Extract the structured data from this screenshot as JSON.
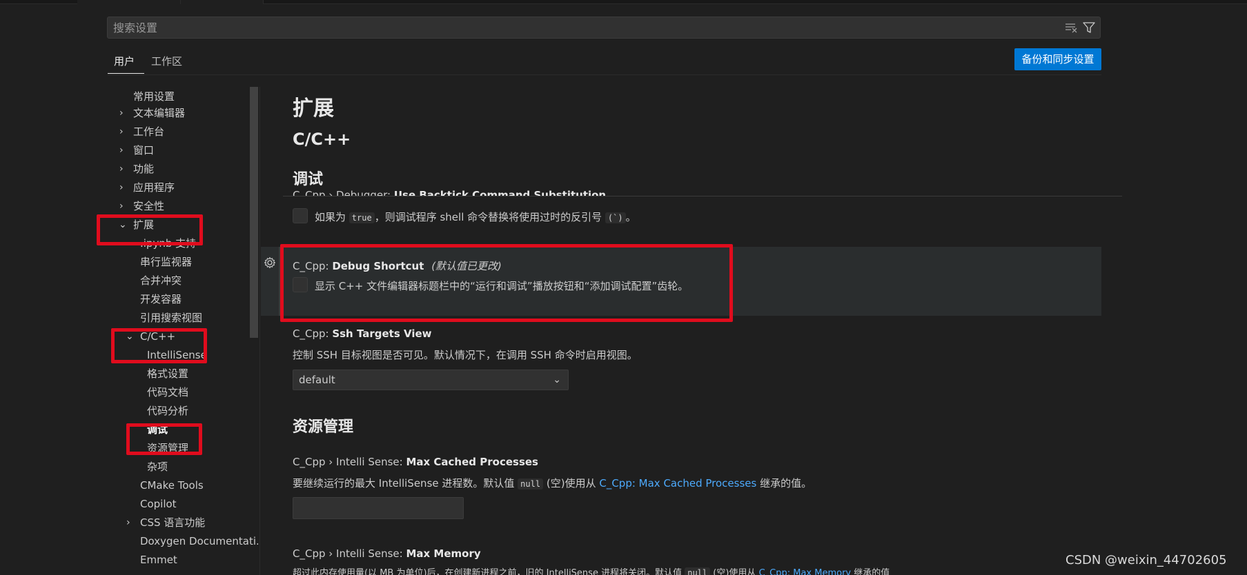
{
  "search": {
    "placeholder": "搜索设置"
  },
  "tabs": {
    "user": "用户",
    "workspace": "工作区"
  },
  "backup_button": "备份和同步设置",
  "sidebar": {
    "items": [
      {
        "label": "常用设置"
      },
      {
        "label": "文本编辑器"
      },
      {
        "label": "工作台"
      },
      {
        "label": "窗口"
      },
      {
        "label": "功能"
      },
      {
        "label": "应用程序"
      },
      {
        "label": "安全性"
      },
      {
        "label": "扩展"
      },
      {
        "label": ".ipynb 支持"
      },
      {
        "label": "串行监视器"
      },
      {
        "label": "合并冲突"
      },
      {
        "label": "开发容器"
      },
      {
        "label": "引用搜索视图"
      },
      {
        "label": "C/C++"
      },
      {
        "label": "IntelliSense"
      },
      {
        "label": "格式设置"
      },
      {
        "label": "代码文档"
      },
      {
        "label": "代码分析"
      },
      {
        "label": "调试"
      },
      {
        "label": "资源管理"
      },
      {
        "label": "杂项"
      },
      {
        "label": "CMake Tools"
      },
      {
        "label": "Copilot"
      },
      {
        "label": "CSS 语言功能"
      },
      {
        "label": "Doxygen Documentati..."
      },
      {
        "label": "Emmet"
      }
    ]
  },
  "main": {
    "h_extensions": "扩展",
    "h_cpp": "C/C++",
    "h_debug": "调试",
    "backtick": {
      "title_prefix": "C_Cpp › Debugger: ",
      "title_bold": "Use Backtick Command Substitution",
      "desc_pre": "如果为",
      "desc_code1": "true",
      "desc_mid": "，则调试程序 shell 命令替换将使用过时的反引号",
      "desc_code2": "(`)",
      "desc_post": "。"
    },
    "debug_shortcut": {
      "title_prefix": "C_Cpp: ",
      "title_bold": "Debug Shortcut",
      "modified": "(默认值已更改)",
      "desc": "显示 C++ 文件编辑器标题栏中的“运行和调试”播放按钮和“添加调试配置”齿轮。"
    },
    "ssh_targets": {
      "title_prefix": "C_Cpp: ",
      "title_bold": "Ssh Targets View",
      "desc": "控制 SSH 目标视图是否可见。默认情况下，在调用 SSH 命令时启用视图。",
      "select_value": "default"
    },
    "h_resource": "资源管理",
    "max_cached": {
      "title_prefix": "C_Cpp › Intelli Sense: ",
      "title_bold": "Max Cached Processes",
      "desc_pre": "要继续运行的最大 IntelliSense 进程数。默认值",
      "desc_code": "null",
      "desc_mid": "(空)使用从",
      "desc_link": "C_Cpp: Max Cached Processes",
      "desc_post": "继承的值。"
    },
    "max_memory": {
      "title_prefix": "C_Cpp › Intelli Sense: ",
      "title_bold": "Max Memory",
      "desc_pre": "超过此内存使用量(以 MB 为单位)后，在创建新进程之前，旧的 IntelliSense 进程将关闭。默认值",
      "desc_code": "null",
      "desc_mid": "(空)使用从",
      "desc_link": "C_Cpp: Max Memory",
      "desc_post": "继承的值"
    }
  },
  "watermark": "CSDN @weixin_44702605",
  "colors": {
    "accent": "#0078d4",
    "annotation_red": "#e00c1d",
    "link": "#4daafc"
  }
}
